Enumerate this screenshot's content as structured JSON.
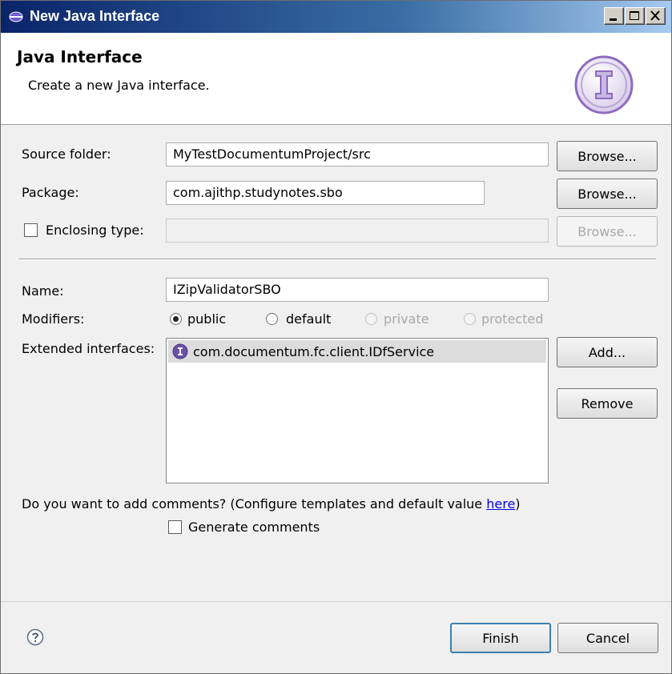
{
  "window": {
    "title": "New Java Interface",
    "controls": {
      "minimize": "minimize",
      "maximize": "maximize",
      "close": "close"
    }
  },
  "header": {
    "title": "Java Interface",
    "description": "Create a new Java interface."
  },
  "form": {
    "source_folder": {
      "label": "Source folder:",
      "value": "MyTestDocumentumProject/src",
      "browse_label": "Browse..."
    },
    "package": {
      "label": "Package:",
      "value": "com.ajithp.studynotes.sbo",
      "browse_label": "Browse..."
    },
    "enclosing_type": {
      "label": "Enclosing type:",
      "checked": false,
      "value": "",
      "browse_label": "Browse...",
      "enabled": false
    },
    "name": {
      "label": "Name:",
      "value": "IZipValidatorSBO"
    },
    "modifiers": {
      "label": "Modifiers:",
      "options": [
        {
          "label": "public",
          "selected": true,
          "enabled": true
        },
        {
          "label": "default",
          "selected": false,
          "enabled": true
        },
        {
          "label": "private",
          "selected": false,
          "enabled": false
        },
        {
          "label": "protected",
          "selected": false,
          "enabled": false
        }
      ]
    },
    "extended_interfaces": {
      "label": "Extended interfaces:",
      "items": [
        "com.documentum.fc.client.IDfService"
      ],
      "add_label": "Add...",
      "remove_label": "Remove"
    },
    "comments": {
      "question": "Do you want to add comments? (Configure templates and default value ",
      "link": "here",
      "question_end": ")",
      "generate_label": "Generate comments",
      "generate_checked": false
    }
  },
  "footer": {
    "finish_label": "Finish",
    "cancel_label": "Cancel"
  },
  "icons": {
    "window": "java-interface-window-icon",
    "header": "interface-wizard-icon",
    "help": "help-icon",
    "list_item": "interface-icon"
  },
  "colors": {
    "titlebar_start": "#0a246a",
    "header_icon": "#8e6bbf",
    "link": "#0000ee"
  }
}
